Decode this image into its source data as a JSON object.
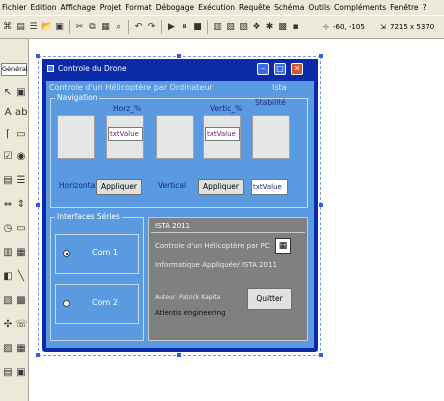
{
  "menu": [
    "Fichier",
    "Edition",
    "Affichage",
    "Projet",
    "Format",
    "Débogage",
    "Exécution",
    "Requête",
    "Schéma",
    "Outils",
    "Compléments",
    "Fenêtre",
    "?"
  ],
  "toolbar": {
    "position": "-60, -105",
    "size": "7215 x 5370"
  },
  "toolbox": {
    "title": "Général"
  },
  "form": {
    "title": "Controle du Drone",
    "heading": "Controle d'un Hélicoptère par Ordinateur",
    "ista": "Ista",
    "navigation": {
      "label": "Navigation",
      "horz_label": "Horz_%",
      "vertic_label": "Vertic_%",
      "stability_label": "Stabilité",
      "horz_value": "txtValue",
      "vertic_value": "txtValue",
      "horizontal_label": "Horizontal",
      "vertical_label": "Vertical",
      "apply1": "Appliquer",
      "apply2": "Appliquer",
      "bottom_value": "txtValue"
    },
    "serial": {
      "label": "Interfaces Séries",
      "com1": "Com 1",
      "com2": "Com 2",
      "selected": "com1"
    },
    "info": {
      "title": "ISTA 2011",
      "line1": "Controle d'un Hélicoptère par PC",
      "line2": "Informatique Appliquée/ ISTA 2011",
      "author": "Auteur: Patrick Kapita",
      "company": "Atlentis engineering",
      "quit": "Quitter"
    }
  }
}
